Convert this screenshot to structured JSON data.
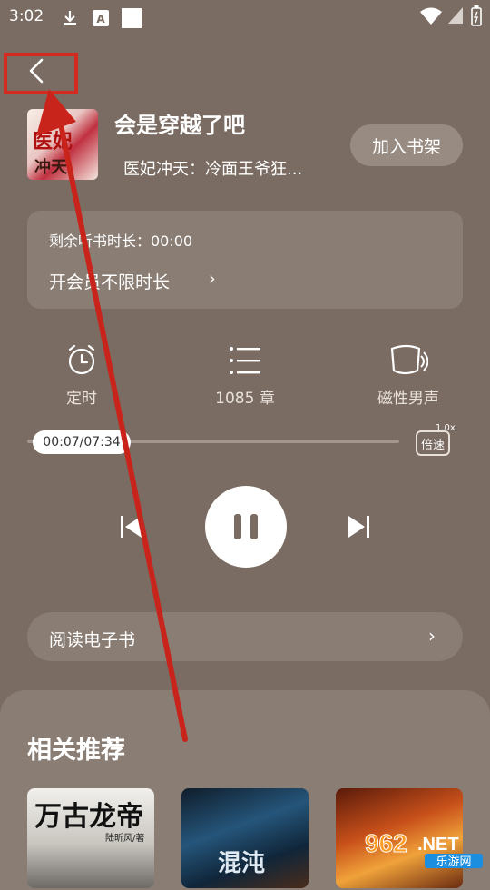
{
  "status_bar": {
    "time": "3:02"
  },
  "book": {
    "cover_text_1": "医妃",
    "cover_text_2": "冲天",
    "title": "会是穿越了吧",
    "subtitle": "医妃冲天：冷面王爷狂...",
    "shelf_button": "加入书架"
  },
  "membership": {
    "remaining_label": "剩余听书时长：00:00",
    "vip_label": "开会员不限时长",
    "chevron": "›"
  },
  "controls": {
    "timer_label": "定时",
    "chapters_label": "1085 章",
    "voice_label": "磁性男声"
  },
  "progress": {
    "time": "00:07/07:34",
    "played_fraction": 0.015,
    "speed_label": "倍速",
    "speed_value": "1.0x"
  },
  "read_ebook": {
    "label": "阅读电子书",
    "chevron": "›"
  },
  "recommendations": {
    "title": "相关推荐",
    "items": [
      {
        "cover_title": "万古龙帝",
        "author": "陆昕风/著"
      },
      {
        "cover_title": "混沌"
      },
      {
        "cover_title": ""
      }
    ]
  },
  "watermark": {
    "brand": "962.NET",
    "sub": "乐游网"
  },
  "colors": {
    "background": "#7a6c62",
    "card": "#8a7d74",
    "annotation_red": "#d42a20"
  }
}
